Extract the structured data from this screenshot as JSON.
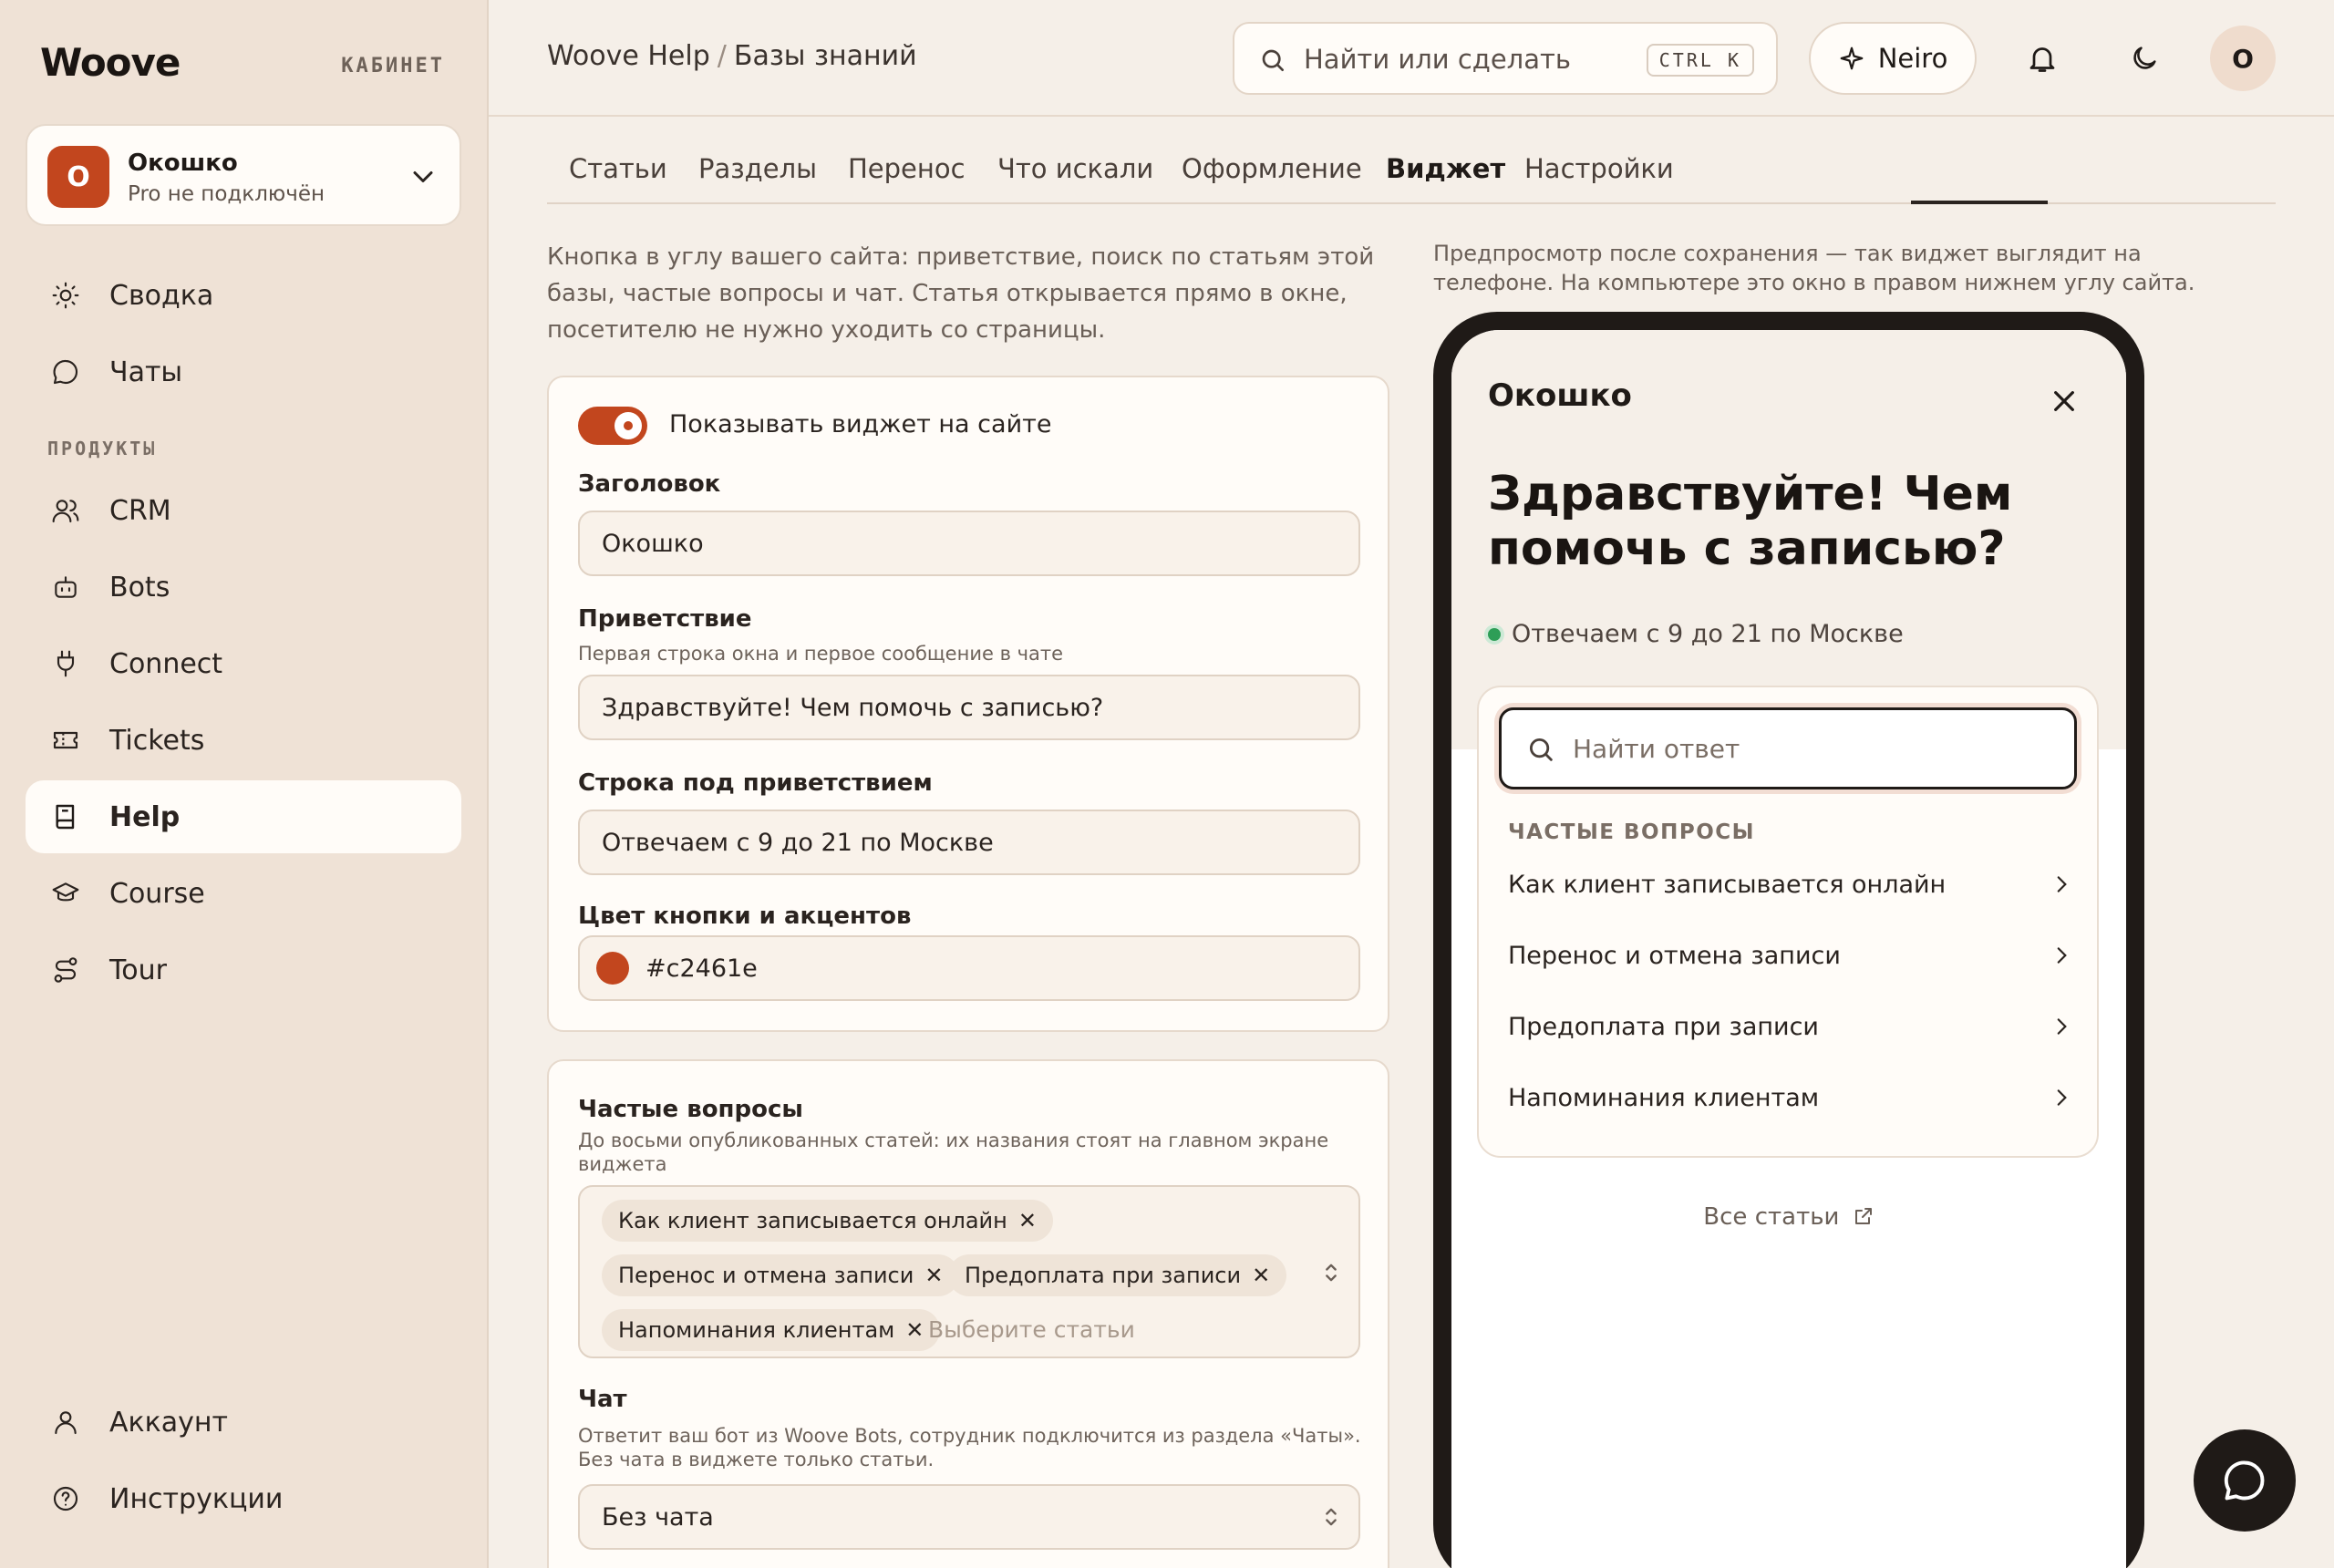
{
  "brand": {
    "logo": "Woove",
    "cabinet": "КАБИНЕТ"
  },
  "org": {
    "initial": "О",
    "name": "Окошко",
    "plan": "Pro не подключён"
  },
  "sidebar": {
    "top_items": [
      {
        "label": "Сводка",
        "icon": "sun-icon"
      },
      {
        "label": "Чаты",
        "icon": "chat-icon"
      }
    ],
    "section_label": "ПРОДУКТЫ",
    "products": [
      {
        "label": "CRM",
        "icon": "users-icon"
      },
      {
        "label": "Bots",
        "icon": "bot-icon"
      },
      {
        "label": "Connect",
        "icon": "plug-icon"
      },
      {
        "label": "Tickets",
        "icon": "ticket-icon"
      },
      {
        "label": "Help",
        "icon": "book-icon",
        "active": true
      },
      {
        "label": "Course",
        "icon": "graduation-cap-icon"
      },
      {
        "label": "Tour",
        "icon": "route-icon"
      }
    ],
    "bottom_items": [
      {
        "label": "Аккаунт",
        "icon": "user-icon"
      },
      {
        "label": "Инструкции",
        "icon": "help-circle-icon"
      }
    ]
  },
  "header": {
    "breadcrumb": [
      "Woove Help",
      "Базы знаний"
    ],
    "breadcrumb_sep": "/",
    "search_placeholder": "Найти или сделать",
    "search_shortcut": "CTRL K",
    "neiro_label": "Neiro",
    "user_initial": "О"
  },
  "tabs": [
    "Статьи",
    "Разделы",
    "Перенос",
    "Что искали",
    "Оформление",
    "Виджет",
    "Настройки"
  ],
  "active_tab": "Виджет",
  "form": {
    "intro": "Кнопка в углу вашего сайта: приветствие, поиск по статьям этой базы, частые вопросы и чат. Статья открывается прямо в окне, посетителю не нужно уходить со страницы.",
    "show_widget_label": "Показывать виджет на сайте",
    "show_widget": true,
    "title_label": "Заголовок",
    "title_value": "Окошко",
    "greeting_label": "Приветствие",
    "greeting_hint": "Первая строка окна и первое сообщение в чате",
    "greeting_value": "Здравствуйте! Чем помочь с записью?",
    "subline_label": "Строка под приветствием",
    "subline_value": "Отвечаем с 9 до 21 по Москве",
    "color_label": "Цвет кнопки и акцентов",
    "color_value": "#c2461e",
    "faq_label": "Частые вопросы",
    "faq_hint": "До восьми опубликованных статей: их названия стоят на главном экране виджета",
    "faq_chips": [
      "Как клиент записывается онлайн",
      "Перенос и отмена записи",
      "Предоплата при записи",
      "Напоминания клиентам"
    ],
    "faq_placeholder": "Выберите статьи",
    "chat_label": "Чат",
    "chat_hint": "Ответит ваш бот из Woove Bots, сотрудник подключится из раздела «Чаты». Без чата в виджете только статьи.",
    "chat_value": "Без чата"
  },
  "preview": {
    "hint": "Предпросмотр после сохранения — так виджет выглядит на телефоне. На компьютере это окно в правом нижнем углу сайта.",
    "widget_name": "Окошко",
    "greeting": "Здравствуйте! Чем помочь с записью?",
    "status": "Отвечаем с 9 до 21 по Москве",
    "search_placeholder": "Найти ответ",
    "faq_heading": "ЧАСТЫЕ ВОПРОСЫ",
    "faq_items": [
      "Как клиент записывается онлайн",
      "Перенос и отмена записи",
      "Предоплата при записи",
      "Напоминания клиентам"
    ],
    "all_articles": "Все статьи"
  },
  "colors": {
    "accent": "#c2461e",
    "sidebar_bg": "#efe2d6",
    "page_bg": "#f5efe8",
    "dark": "#1f1a17",
    "status_green": "#2e9e57"
  }
}
